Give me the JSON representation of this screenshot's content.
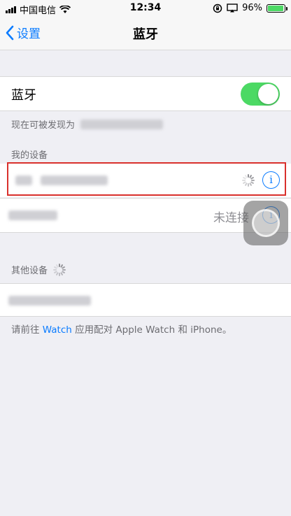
{
  "status_bar": {
    "carrier": "中国电信",
    "time": "12:34",
    "battery_percent": "96%",
    "battery_level": 0.96,
    "icons": [
      "signal-icon",
      "wifi-icon",
      "rotation-lock-icon",
      "screen-mirroring-icon",
      "battery-icon"
    ]
  },
  "nav": {
    "back_label": "设置",
    "title": "蓝牙"
  },
  "bluetooth": {
    "label": "蓝牙",
    "enabled": true,
    "toggle_color": "#4cd964"
  },
  "discoverable": {
    "prefix": "现在可被发现为"
  },
  "my_devices": {
    "header": "我的设备",
    "items": [
      {
        "name_hidden": true,
        "status": "",
        "connecting": true
      },
      {
        "name_hidden": true,
        "status": "未连接",
        "connecting": false
      }
    ]
  },
  "other_devices": {
    "header": "其他设备",
    "searching": true
  },
  "watch_note": {
    "before": "请前往 ",
    "link": "Watch",
    "after": " 应用配对 Apple Watch 和 iPhone。"
  },
  "colors": {
    "accent": "#0b7cff",
    "highlight": "#d9302c",
    "background": "#efeff4"
  }
}
